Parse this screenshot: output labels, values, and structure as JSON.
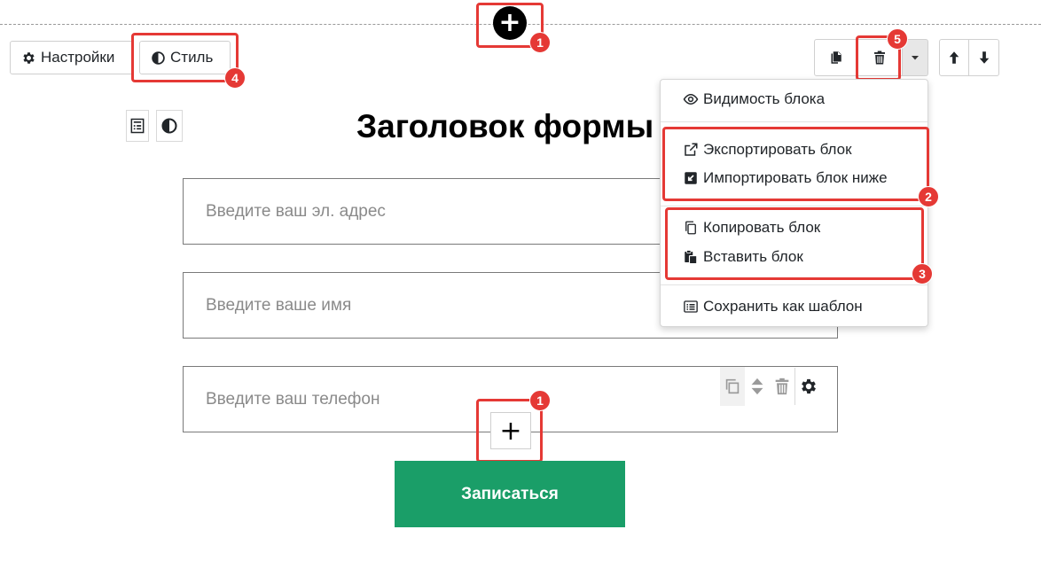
{
  "toolbar": {
    "settings_label": "Настройки",
    "style_label": "Стиль"
  },
  "dropdown": {
    "visibility": "Видимость блока",
    "export": "Экспортировать блок",
    "import": "Импортировать блок ниже",
    "copy": "Копировать блок",
    "paste": "Вставить блок",
    "save_template": "Сохранить как шаблон"
  },
  "form": {
    "title": "Заголовок формы",
    "email_placeholder": "Введите ваш эл. адрес",
    "name_placeholder": "Введите ваше имя",
    "phone_placeholder": "Введите ваш телефон",
    "submit_label": "Записаться"
  },
  "annotations": {
    "badge1": "1",
    "badge2": "2",
    "badge3": "3",
    "badge4": "4",
    "badge5": "5"
  },
  "icons": {
    "add": "+",
    "add_field": "+"
  },
  "colors": {
    "accent_green": "#1a9e68",
    "annotation_red": "#e53935"
  }
}
